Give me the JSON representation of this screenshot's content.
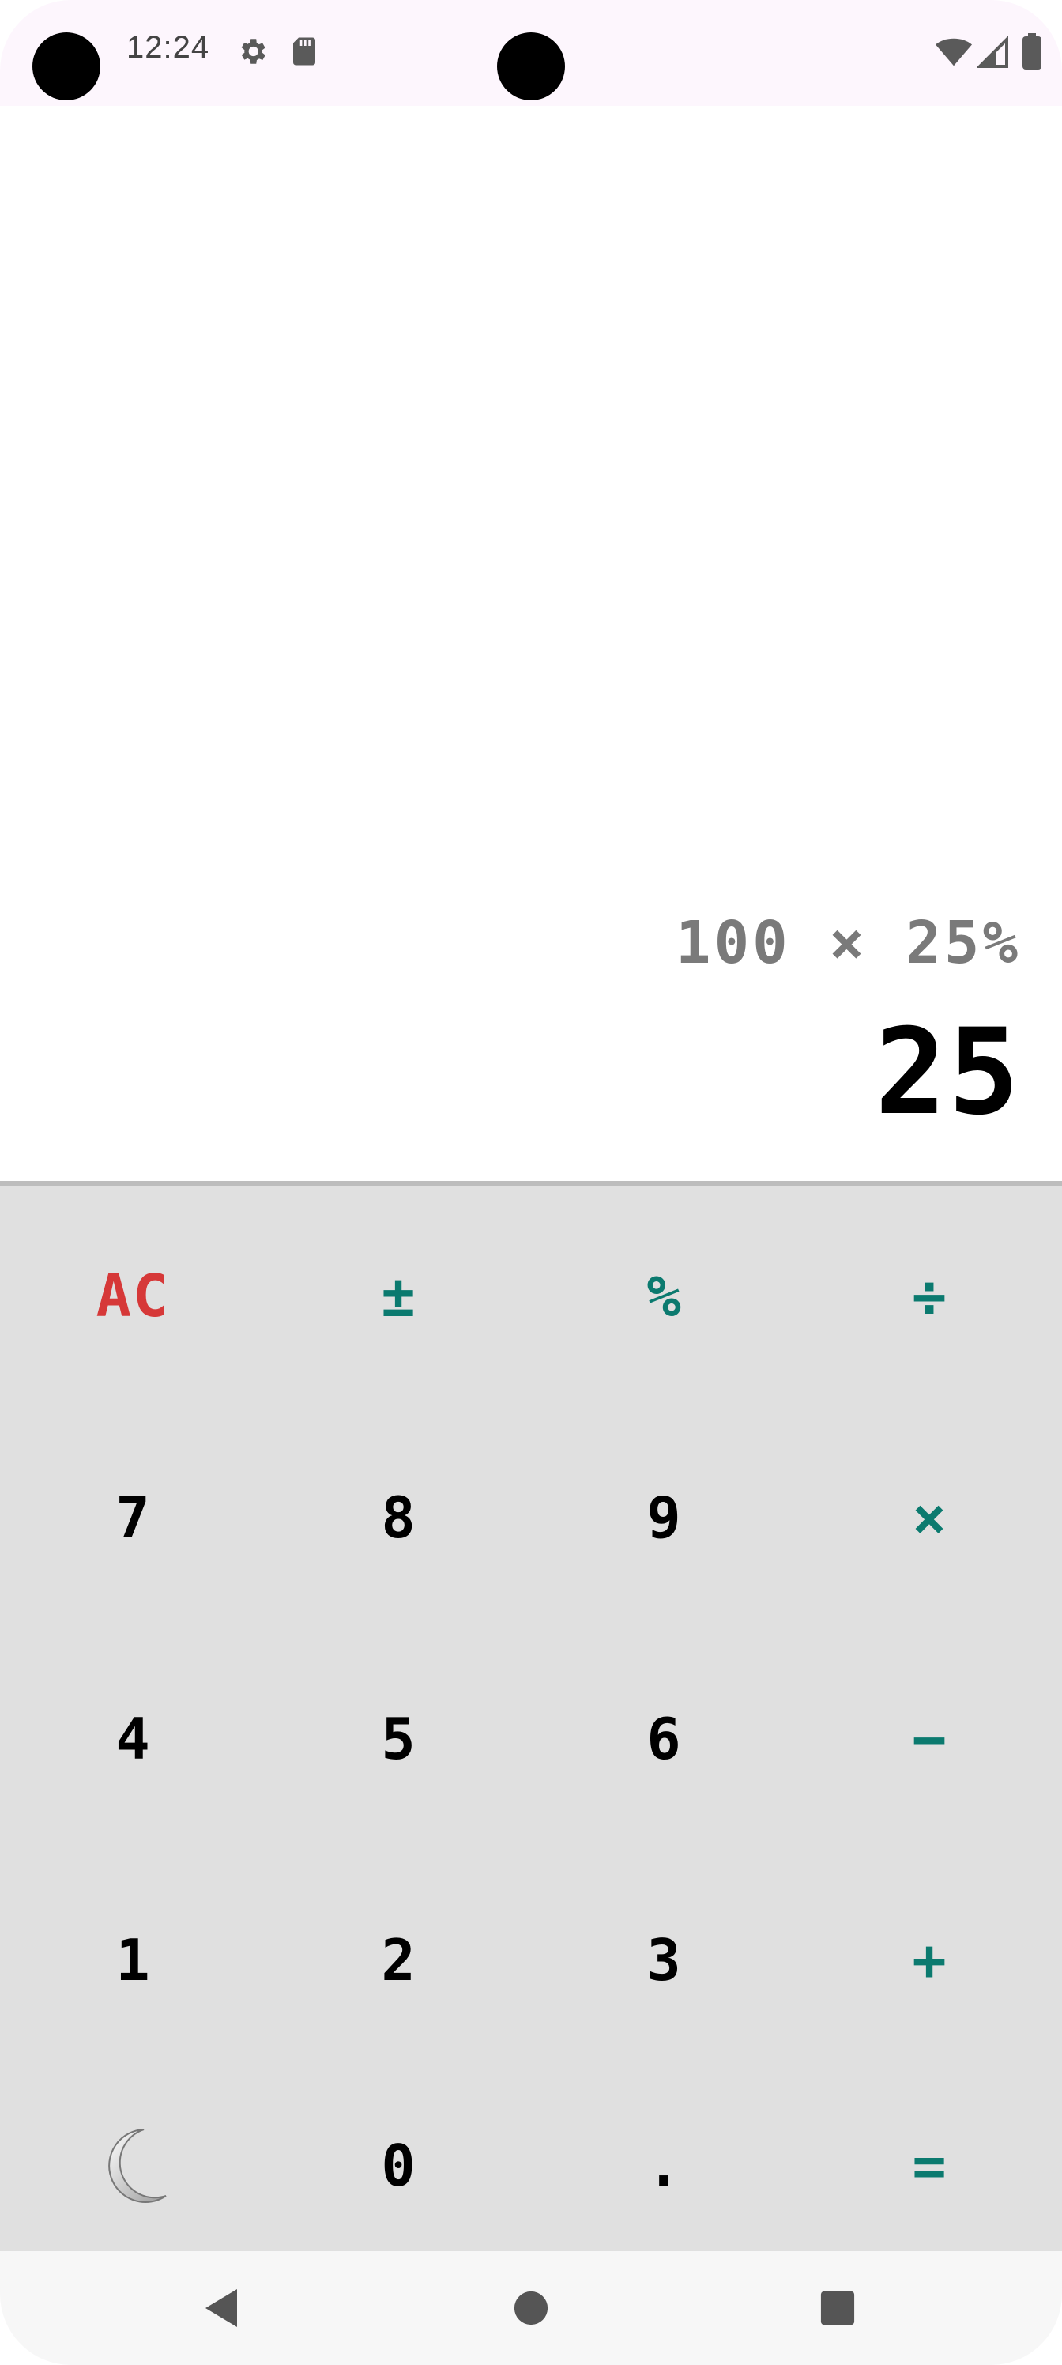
{
  "status_bar": {
    "time": "12:24",
    "icons": [
      "settings-icon",
      "sd-card-icon",
      "wifi-icon",
      "cellular-signal-icon",
      "battery-icon"
    ]
  },
  "display": {
    "expression": "100 × 25%",
    "result": "25"
  },
  "keypad": {
    "rows": [
      [
        {
          "label": "AC",
          "kind": "clear"
        },
        {
          "label": "±",
          "kind": "op"
        },
        {
          "label": "%",
          "kind": "op"
        },
        {
          "label": "÷",
          "kind": "op"
        }
      ],
      [
        {
          "label": "7",
          "kind": "digit"
        },
        {
          "label": "8",
          "kind": "digit"
        },
        {
          "label": "9",
          "kind": "digit"
        },
        {
          "label": "×",
          "kind": "op"
        }
      ],
      [
        {
          "label": "4",
          "kind": "digit"
        },
        {
          "label": "5",
          "kind": "digit"
        },
        {
          "label": "6",
          "kind": "digit"
        },
        {
          "label": "−",
          "kind": "op"
        }
      ],
      [
        {
          "label": "1",
          "kind": "digit"
        },
        {
          "label": "2",
          "kind": "digit"
        },
        {
          "label": "3",
          "kind": "digit"
        },
        {
          "label": "+",
          "kind": "op"
        }
      ],
      [
        {
          "label": "",
          "kind": "theme",
          "icon": "moon-icon"
        },
        {
          "label": "0",
          "kind": "digit"
        },
        {
          "label": ".",
          "kind": "digit"
        },
        {
          "label": "=",
          "kind": "op"
        }
      ]
    ]
  },
  "colors": {
    "operator": "#0b7a6f",
    "clear": "#d63838",
    "keypad_bg": "#e0e0e0",
    "expression": "#7a7a7a"
  },
  "nav_bar": {
    "icons": [
      "back-icon",
      "home-icon",
      "recents-icon"
    ]
  }
}
